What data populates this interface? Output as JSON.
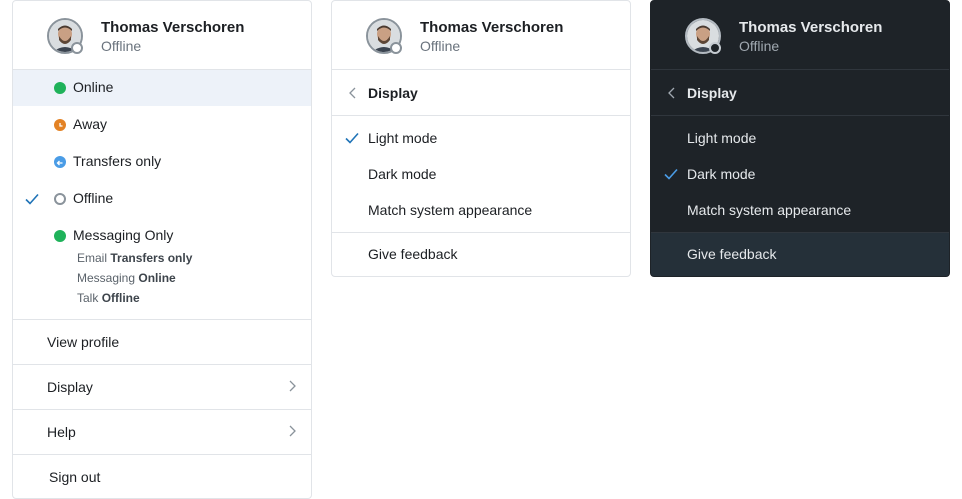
{
  "user": {
    "name": "Thomas Verschoren",
    "status": "Offline"
  },
  "status_menu": {
    "items": [
      {
        "label": "Online",
        "color": "#1fb25a"
      },
      {
        "label": "Away",
        "color": "#e38224"
      },
      {
        "label": "Transfers only",
        "color": "#4a9ce6"
      },
      {
        "label": "Offline",
        "selected": true
      },
      {
        "label": "Messaging Only",
        "color": "#1fb25a"
      }
    ],
    "details": [
      {
        "channel": "Email",
        "value": "Transfers only"
      },
      {
        "channel": "Messaging",
        "value": "Online"
      },
      {
        "channel": "Talk",
        "value": "Offline"
      }
    ]
  },
  "main_menu": {
    "view_profile": "View profile",
    "display": "Display",
    "help": "Help",
    "sign_out": "Sign out"
  },
  "display_menu": {
    "title": "Display",
    "options": [
      "Light mode",
      "Dark mode",
      "Match system appearance"
    ],
    "feedback": "Give feedback"
  },
  "colors": {
    "check": "#1f73b7",
    "dark_bg": "#1e2328",
    "hover_light": "#edf2f9"
  },
  "icons": {
    "check": "check-icon",
    "chevron_right": "chevron-right-icon",
    "chevron_left": "chevron-left-icon"
  }
}
